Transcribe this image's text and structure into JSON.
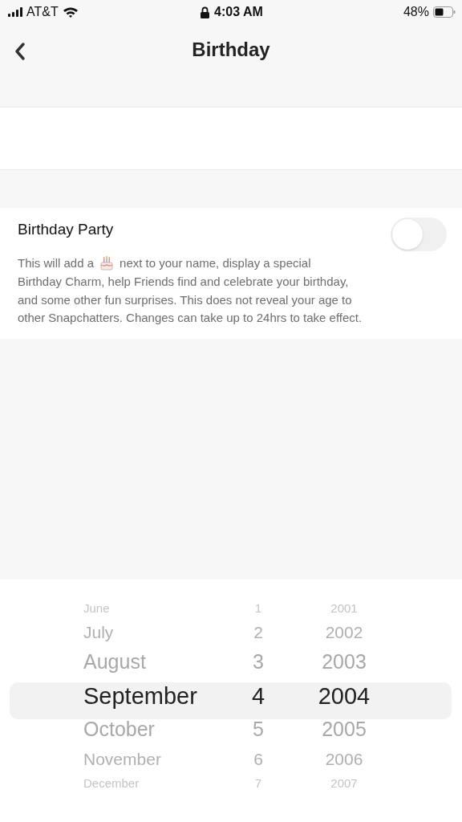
{
  "status_bar": {
    "carrier": "AT&T",
    "time": "4:03 AM",
    "battery": "48%"
  },
  "nav": {
    "title": "Birthday"
  },
  "birthday_party": {
    "label": "Birthday Party",
    "on": false,
    "description_before": "This will add a",
    "description_after": "next to your name, display a special",
    "description_rest": "Birthday Charm, help Friends find and celebrate your birthday, and some other fun surprises. This does not reveal your age to other Snapchatters. Changes can take up to 24hrs to take effect."
  },
  "picker": {
    "rows": [
      {
        "month": "June",
        "day": "1",
        "year": "2001",
        "selected": false
      },
      {
        "month": "July",
        "day": "2",
        "year": "2002",
        "selected": false
      },
      {
        "month": "August",
        "day": "3",
        "year": "2003",
        "selected": false
      },
      {
        "month": "September",
        "day": "4",
        "year": "2004",
        "selected": true
      },
      {
        "month": "October",
        "day": "5",
        "year": "2005",
        "selected": false
      },
      {
        "month": "November",
        "day": "6",
        "year": "2006",
        "selected": false
      },
      {
        "month": "December",
        "day": "7",
        "year": "2007",
        "selected": false
      }
    ]
  }
}
